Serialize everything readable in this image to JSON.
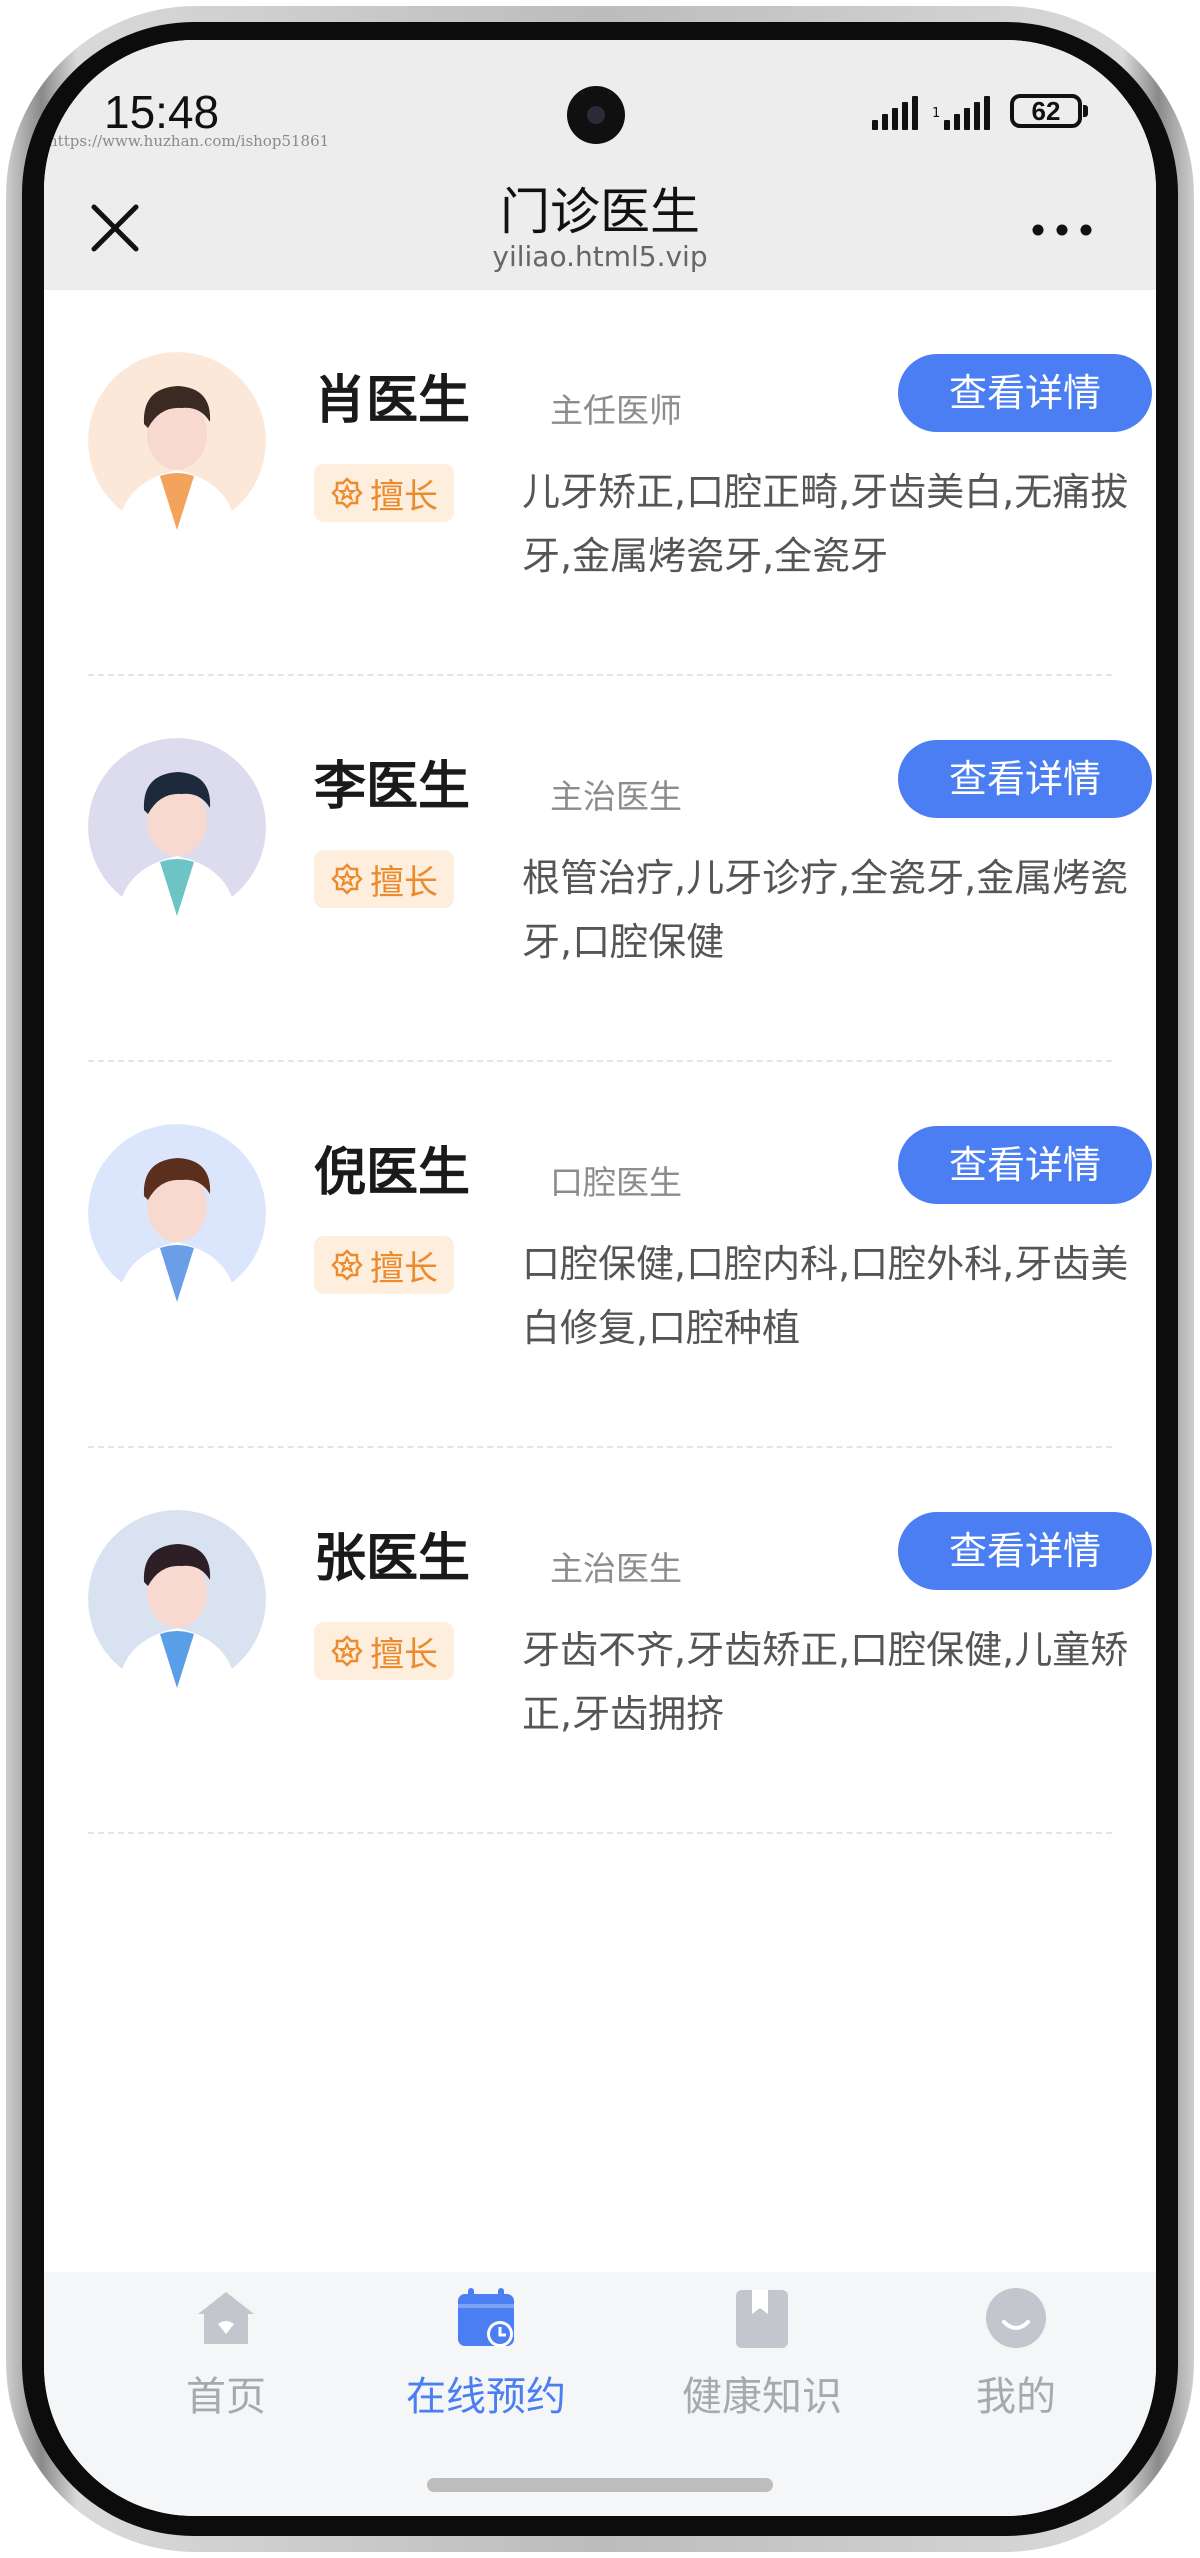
{
  "status_bar": {
    "time": "15:48",
    "watermark": "https://www.huzhan.com/ishop51861",
    "battery": "62",
    "icons": [
      "signal-icon",
      "signal-icon",
      "battery-icon"
    ]
  },
  "header": {
    "title": "门诊医生",
    "subtitle": "yiliao.html5.vip",
    "close_icon": "close-icon",
    "more_icon": "more-icon"
  },
  "doctors": [
    {
      "name": "肖医生",
      "title": "主任医师",
      "button": "查看详情",
      "tag": "擅长",
      "skills": "儿牙矫正,口腔正畸,牙齿美白,无痛拔牙,金属烤瓷牙,全瓷牙",
      "avatar_bg": "#fbe8d9",
      "shirt_color": "#f4a35c",
      "hair_color": "#3a2a22"
    },
    {
      "name": "李医生",
      "title": "主治医生",
      "button": "查看详情",
      "tag": "擅长",
      "skills": "根管治疗,儿牙诊疗,全瓷牙,金属烤瓷牙,口腔保健",
      "avatar_bg": "#dcdcee",
      "shirt_color": "#6cc4c4",
      "hair_color": "#1c2a3c"
    },
    {
      "name": "倪医生",
      "title": "口腔医生",
      "button": "查看详情",
      "tag": "擅长",
      "skills": "口腔保健,口腔内科,口腔外科,牙齿美白修复,口腔种植",
      "avatar_bg": "#dbe6fc",
      "shirt_color": "#6b9ee6",
      "hair_color": "#5a2f1d"
    },
    {
      "name": "张医生",
      "title": "主治医生",
      "button": "查看详情",
      "tag": "擅长",
      "skills": "牙齿不齐,牙齿矫正,口腔保健,儿童矫正,牙齿拥挤",
      "avatar_bg": "#d8e2f0",
      "shirt_color": "#5b9ee8",
      "hair_color": "#2e1f26"
    }
  ],
  "tabbar": {
    "items": [
      {
        "label": "首页",
        "icon": "home-icon",
        "active": false
      },
      {
        "label": "在线预约",
        "icon": "calendar-icon",
        "active": true
      },
      {
        "label": "健康知识",
        "icon": "bookmark-icon",
        "active": false
      },
      {
        "label": "我的",
        "icon": "profile-icon",
        "active": false
      }
    ]
  },
  "colors": {
    "accent": "#4a7ef2",
    "tag_bg": "#fdeedd",
    "tag_text": "#ec8b2e",
    "tab_inactive": "#a6a9b0"
  }
}
